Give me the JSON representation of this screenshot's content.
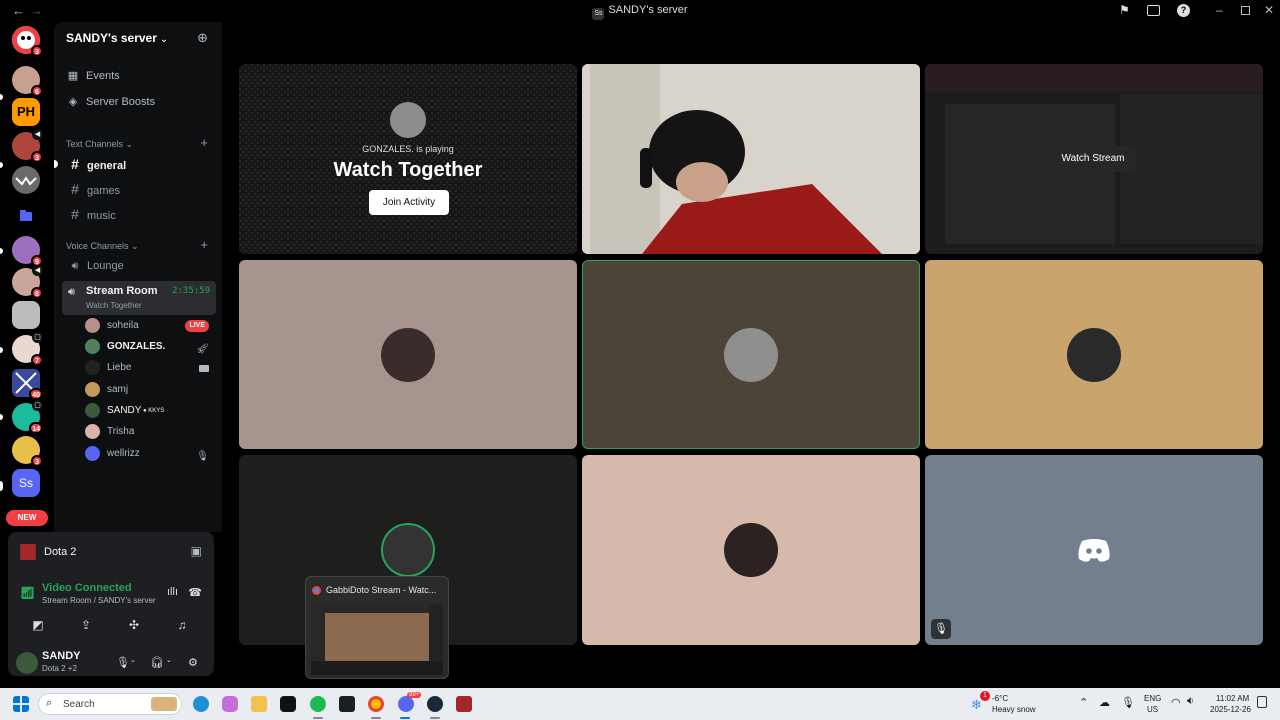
{
  "window": {
    "title": "SANDY's server",
    "title_icon": "Ss",
    "back_glyph": "←",
    "forward_glyph": "→"
  },
  "server_rail": {
    "badges": [
      "3",
      "6",
      "3",
      "9",
      "8",
      "7",
      "40",
      "14",
      "3"
    ],
    "new_label": "NEW",
    "active_server_initials": "Ss"
  },
  "sidebar": {
    "server_name": "SANDY's server",
    "nav": [
      {
        "label": "Events",
        "icon": "calendar-icon"
      },
      {
        "label": "Server Boosts",
        "icon": "boost-icon"
      }
    ],
    "text_category": "Text Channels",
    "text_channels": [
      "general",
      "games",
      "music"
    ],
    "voice_category": "Voice Channels",
    "voice_channels": [
      "Lounge"
    ],
    "active_voice": {
      "name": "Stream Room",
      "subtitle": "Watch Together",
      "elapsed": "2:35:59"
    },
    "voice_users": [
      {
        "name": "soheila",
        "tag": "LIVE"
      },
      {
        "name": "GONZALES.",
        "tag": "rocket-icon"
      },
      {
        "name": "Liebe",
        "tag": "camera-icon"
      },
      {
        "name": "samj",
        "tag": ""
      },
      {
        "name": "SANDY",
        "tag": "KKYS"
      },
      {
        "name": "Trisha",
        "tag": ""
      },
      {
        "name": "wellrizz",
        "tag": "mic-muted-icon"
      }
    ]
  },
  "activity": {
    "game": "Dota 2"
  },
  "voice_panel": {
    "status": "Video Connected",
    "location": "Stream Room / SANDY's server"
  },
  "user_panel": {
    "name": "SANDY",
    "status": "Dota 2 +2"
  },
  "stage": {
    "activity_tile": {
      "player_text": "GONZALES. is playing",
      "activity_name": "Watch Together",
      "join_label": "Join Activity"
    },
    "stream_tile": {
      "watch_label": "Watch Stream"
    }
  },
  "preview": {
    "title": "GabbiDoto Stream - Watc..."
  },
  "taskbar": {
    "search_placeholder": "Search",
    "weather_temp": "-6°C",
    "weather_desc": "Heavy snow",
    "weather_badge": "1",
    "lang_top": "ENG",
    "lang_bottom": "US",
    "time": "11:02 AM",
    "date": "2025-12-26",
    "discord_badge": "99+"
  },
  "colors": {
    "accent_green": "#23a55a",
    "alert_red": "#f23f43",
    "blurple": "#5865f2"
  }
}
